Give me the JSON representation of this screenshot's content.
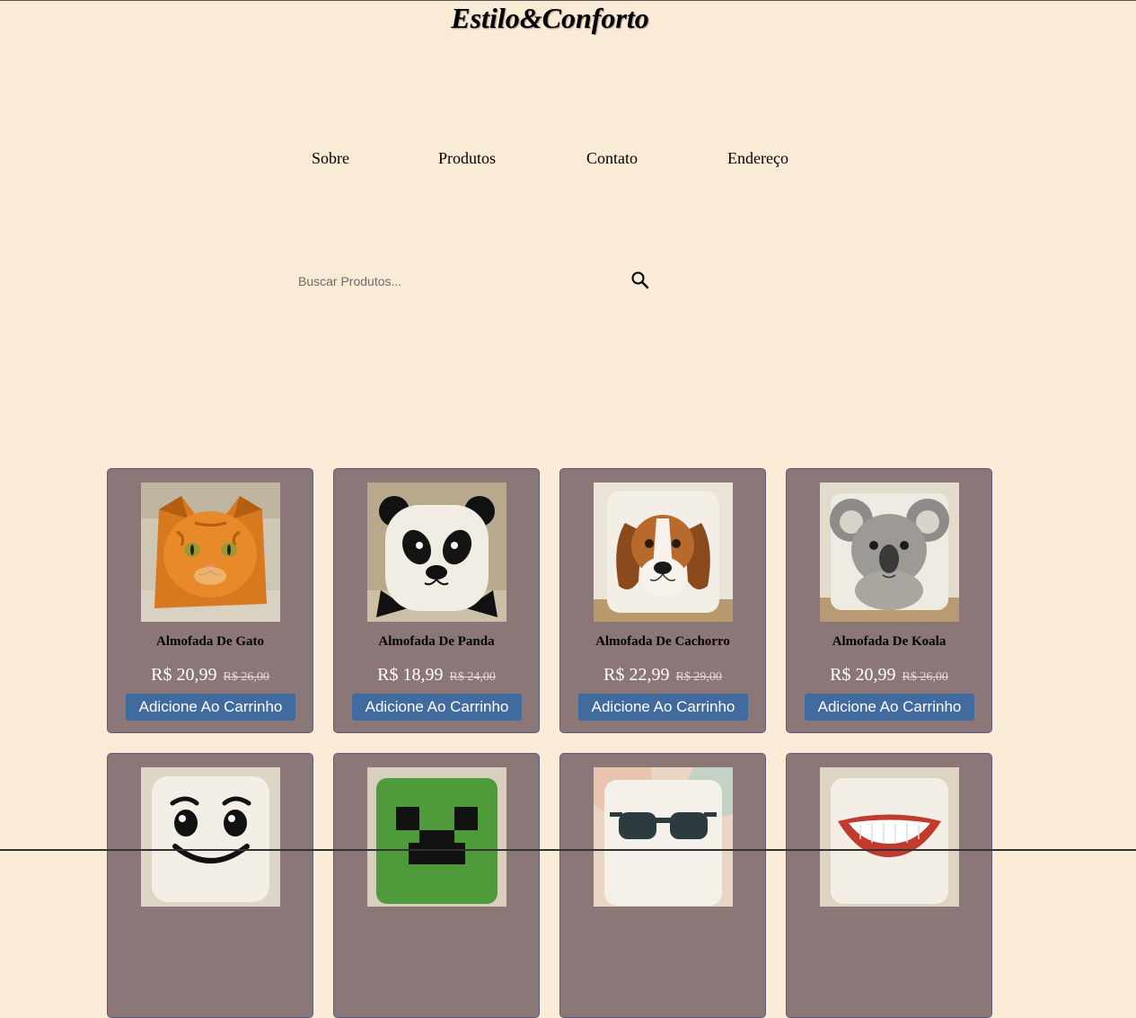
{
  "header": {
    "logo": "Estilo&Conforto"
  },
  "nav": {
    "items": [
      {
        "label": "Sobre"
      },
      {
        "label": "Produtos"
      },
      {
        "label": "Contato"
      },
      {
        "label": "Endereço"
      }
    ]
  },
  "search": {
    "placeholder": "Buscar Produtos...",
    "icon": "search-icon"
  },
  "products": [
    {
      "name": "Almofada De Gato",
      "price": "R$ 20,99",
      "old_price": "R$ 26,00",
      "button": "Adicione Ao Carrinho",
      "image": "orange-cat-pillow"
    },
    {
      "name": "Almofada De Panda",
      "price": "R$ 18,99",
      "old_price": "R$ 24,00",
      "button": "Adicione Ao Carrinho",
      "image": "panda-pillow"
    },
    {
      "name": "Almofada De Cachorro",
      "price": "R$ 22,99",
      "old_price": "R$ 29,00",
      "button": "Adicione Ao Carrinho",
      "image": "beagle-pillow"
    },
    {
      "name": "Almofada De Koala",
      "price": "R$ 20,99",
      "old_price": "R$ 26,00",
      "button": "Adicione Ao Carrinho",
      "image": "koala-pillow"
    },
    {
      "image": "smiley-face-pillow"
    },
    {
      "image": "creeper-pillow"
    },
    {
      "image": "sunglasses-pillow"
    },
    {
      "image": "lips-smile-pillow"
    }
  ],
  "colors": {
    "background": "#faebd7",
    "card": "#8b7777",
    "button": "#416a9e"
  }
}
